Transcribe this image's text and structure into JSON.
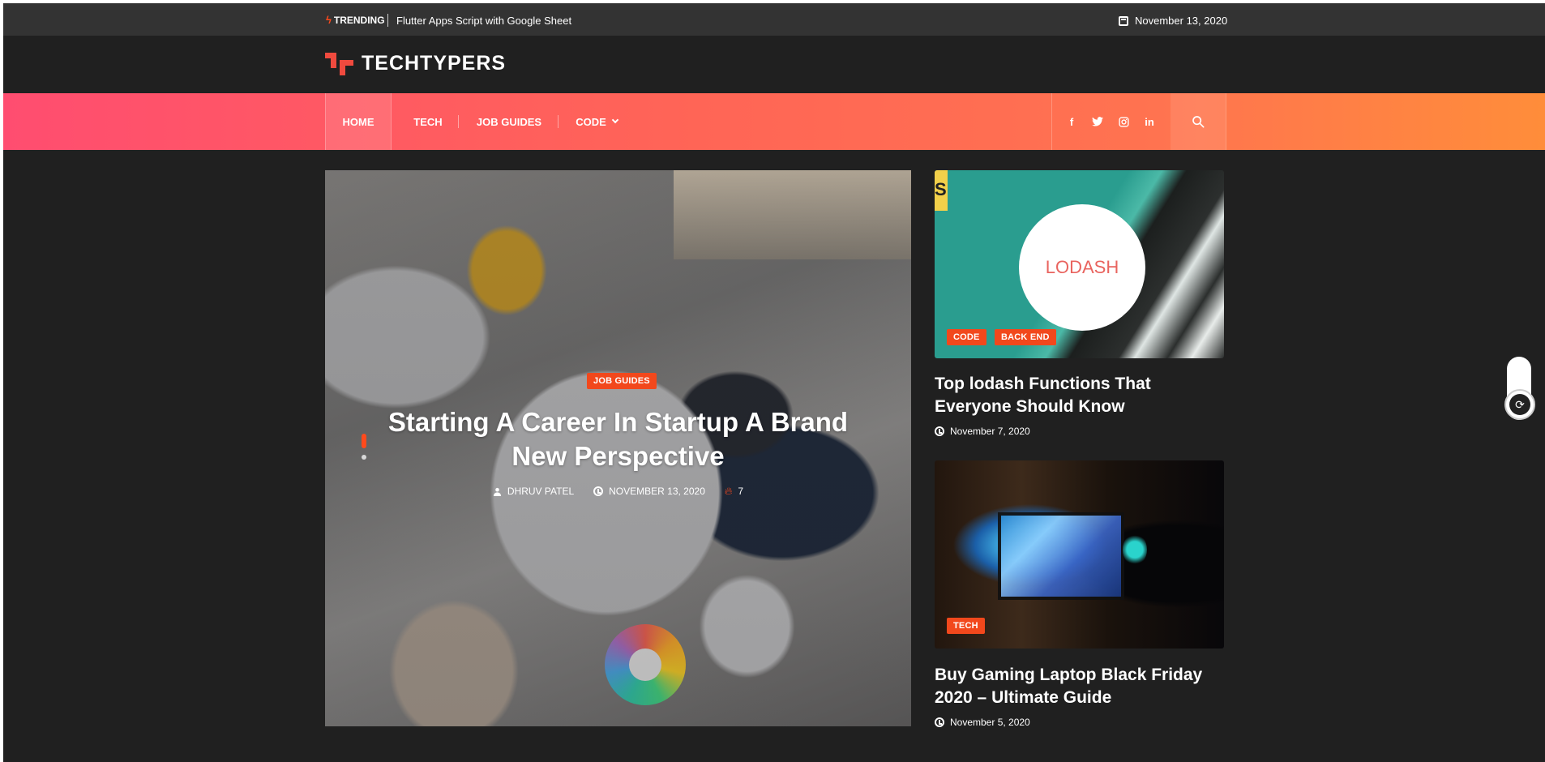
{
  "topbar": {
    "trending_label": "TRENDING",
    "trending_link": "Flutter Apps Script with Google Sheet",
    "date": "November 13, 2020"
  },
  "brand": {
    "name": "TECHTYPERS"
  },
  "nav": {
    "items": [
      {
        "label": "HOME"
      },
      {
        "label": "TECH"
      },
      {
        "label": "JOB GUIDES"
      },
      {
        "label": "CODE"
      }
    ],
    "social": {
      "facebook": "f",
      "twitter": "t",
      "instagram": "ig",
      "linkedin": "in"
    }
  },
  "featured": {
    "category": "JOB GUIDES",
    "title": "Starting A Career In Startup A Brand New Perspective",
    "author": "DHRUV PATEL",
    "date": "NOVEMBER 13, 2020",
    "views": "7"
  },
  "side_posts": [
    {
      "categories": [
        "CODE",
        "BACK END"
      ],
      "image_text": "LODASH",
      "title": "Top lodash Functions That Everyone Should Know",
      "date": "November 7, 2020"
    },
    {
      "categories": [
        "TECH"
      ],
      "title": "Buy Gaming Laptop Black Friday 2020 – Ultimate Guide",
      "date": "November 5, 2020"
    }
  ],
  "colors": {
    "accent": "#f2481c",
    "background": "#202020",
    "topbar": "#333333",
    "nav_gradient_start": "#ff4d70",
    "nav_gradient_end": "#ff8d3a"
  }
}
